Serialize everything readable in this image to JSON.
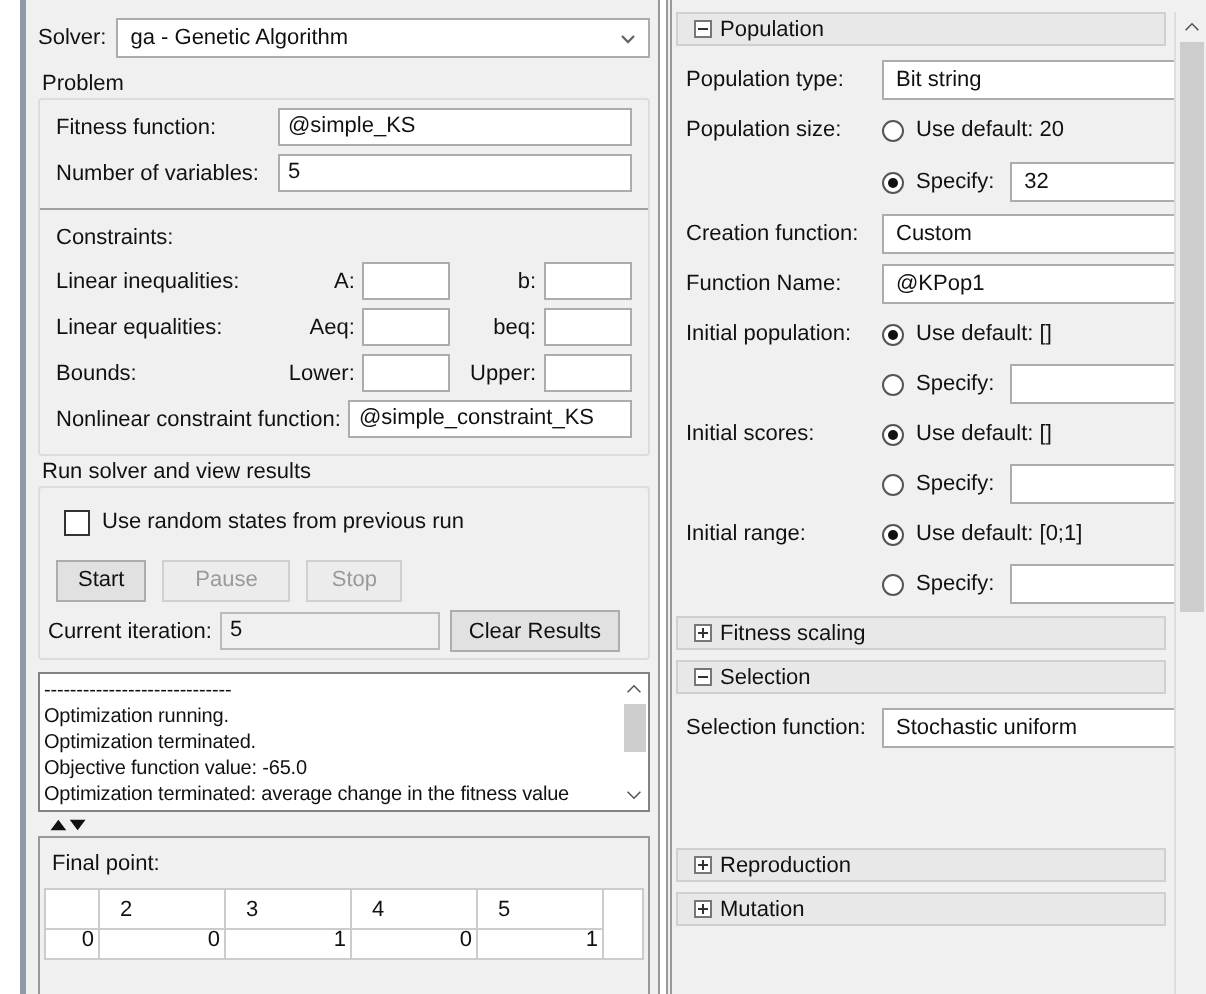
{
  "solver": {
    "label": "Solver:",
    "value": "ga - Genetic Algorithm"
  },
  "problem": {
    "title": "Problem",
    "fields": [
      {
        "label": "Fitness function:",
        "value": "@simple_KS"
      },
      {
        "label": "Number of variables:",
        "value": "5"
      }
    ]
  },
  "constraints": {
    "title": "Constraints:",
    "rows": [
      {
        "label": "Linear inequalities:",
        "first": "A:",
        "second": "b:"
      },
      {
        "label": "Linear equalities:",
        "first": "Aeq:",
        "second": "beq:"
      },
      {
        "label": "Bounds:",
        "first": "Lower:",
        "second": "Upper:"
      }
    ],
    "nonlinear": {
      "label": "Nonlinear constraint function:",
      "value": "@simple_constraint_KS"
    }
  },
  "run": {
    "title": "Run solver and view results",
    "checkbox": {
      "label": "Use random states from previous run",
      "checked": false
    },
    "buttons": [
      {
        "label": "Start",
        "disabled": false
      },
      {
        "label": "Pause",
        "disabled": true
      },
      {
        "label": "Stop",
        "disabled": true
      }
    ],
    "iteration": {
      "label": "Current iteration:",
      "value": "5"
    },
    "clear_button": "Clear Results",
    "log": [
      "-----------------------------",
      "Optimization running.",
      "Optimization terminated.",
      "Objective function value: -65.0",
      "Optimization terminated: average change in the fitness value"
    ]
  },
  "final_point": {
    "title": "Final point:",
    "columns": [
      "2",
      "3",
      "4",
      "5"
    ],
    "values": [
      "0",
      "0",
      "1",
      "0",
      "1"
    ]
  },
  "sections": [
    {
      "title": "Population",
      "expanded": true,
      "rows": [
        {
          "kind": "select",
          "label": "Population type:",
          "value": "Bit string"
        },
        {
          "kind": "radio",
          "label": "Population size:",
          "option": "Use default: 20",
          "selected": false
        },
        {
          "kind": "radio",
          "option": "Specify:",
          "selected": true,
          "value": "32"
        },
        {
          "kind": "select",
          "label": "Creation function:",
          "value": "Custom"
        },
        {
          "kind": "field",
          "label": "Function Name:",
          "value": "@KPop1"
        },
        {
          "kind": "radio",
          "label": "Initial population:",
          "option": "Use default: []",
          "selected": true
        },
        {
          "kind": "radio",
          "option": "Specify:",
          "selected": false,
          "value": ""
        },
        {
          "kind": "radio",
          "label": "Initial scores:",
          "option": "Use default: []",
          "selected": true
        },
        {
          "kind": "radio",
          "option": "Specify:",
          "selected": false,
          "value": ""
        },
        {
          "kind": "radio",
          "label": "Initial range:",
          "option": "Use default: [0;1]",
          "selected": true
        },
        {
          "kind": "radio",
          "option": "Specify:",
          "selected": false,
          "value": ""
        }
      ]
    },
    {
      "title": "Fitness scaling",
      "expanded": false
    },
    {
      "title": "Selection",
      "expanded": true,
      "rows": [
        {
          "kind": "select",
          "label": "Selection function:",
          "value": "Stochastic uniform"
        }
      ]
    },
    {
      "title": "Reproduction",
      "expanded": false
    },
    {
      "title": "Mutation",
      "expanded": false
    }
  ]
}
